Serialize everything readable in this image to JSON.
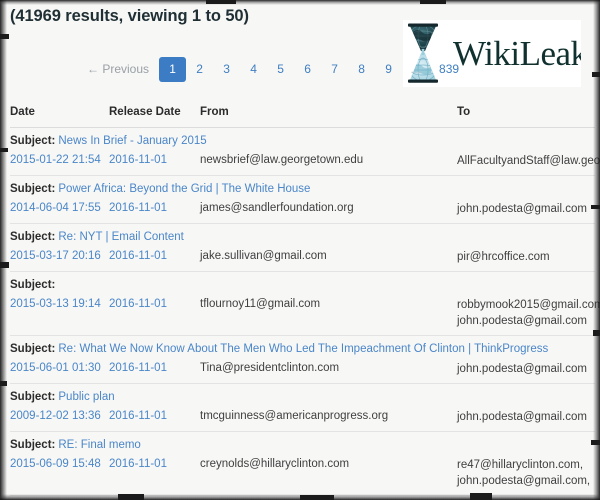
{
  "header": {
    "results_summary": "(41969 results, viewing 1 to 50)"
  },
  "logo": {
    "wordmark": "WikiLeaks",
    "glyph": "hourglass-globe-icon",
    "colors": {
      "wordmark": "#10312f",
      "globe_top": "#1d3f46",
      "globe_bottom": "#a8d5e2"
    }
  },
  "pagination": {
    "previous_label": "← Previous",
    "pages": [
      "1",
      "2",
      "3",
      "4",
      "5",
      "6",
      "7",
      "8",
      "9"
    ],
    "ellipsis": "…",
    "last_page": "839",
    "active_page": "1",
    "active_color": "#3b7cc4",
    "link_color": "#3f7fc1"
  },
  "table": {
    "columns": [
      "Date",
      "Release Date",
      "From",
      "To"
    ],
    "subject_label": "Subject:",
    "rows": [
      {
        "subject": "News In Brief - January 2015",
        "date": "2015-01-22 21:54",
        "release_date": "2016-11-01",
        "from": "newsbrief@law.georgetown.edu",
        "to": [
          "AllFacultyandStaff@law.georget"
        ]
      },
      {
        "subject": "Power Africa: Beyond the Grid | The White House",
        "date": "2014-06-04 17:55",
        "release_date": "2016-11-01",
        "from": "james@sandlerfoundation.org",
        "to": [
          "john.podesta@gmail.com"
        ]
      },
      {
        "subject": "Re: NYT | Email Content",
        "date": "2015-03-17 20:16",
        "release_date": "2016-11-01",
        "from": "jake.sullivan@gmail.com",
        "to": [
          "pir@hrcoffice.com"
        ]
      },
      {
        "subject": "",
        "date": "2015-03-13 19:14",
        "release_date": "2016-11-01",
        "from": "tflournoy11@gmail.com",
        "to": [
          "robbymook2015@gmail.com,",
          "john.podesta@gmail.com"
        ]
      },
      {
        "subject": "Re: What We Now Know About The Men Who Led The Impeachment Of Clinton | ThinkProgress",
        "date": "2015-06-01 01:30",
        "release_date": "2016-11-01",
        "from": "Tina@presidentclinton.com",
        "to": [
          "john.podesta@gmail.com"
        ]
      },
      {
        "subject": "Public plan",
        "date": "2009-12-02 13:36",
        "release_date": "2016-11-01",
        "from": "tmcguinness@americanprogress.org",
        "to": [
          "john.podesta@gmail.com"
        ]
      },
      {
        "subject": "RE: Final memo",
        "date": "2015-06-09 15:48",
        "release_date": "2016-11-01",
        "from": "creynolds@hillaryclinton.com",
        "to": [
          "re47@hillaryclinton.com,",
          "john.podesta@gmail.com,"
        ]
      }
    ]
  }
}
